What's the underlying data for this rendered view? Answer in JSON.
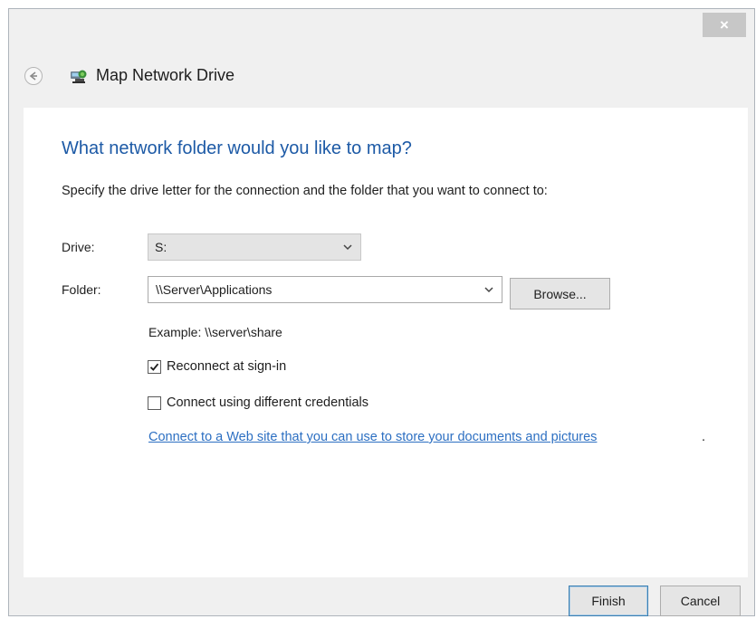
{
  "window": {
    "title": "Map Network Drive",
    "close_label": "×"
  },
  "main": {
    "heading": "What network folder would you like to map?",
    "instructions": "Specify the drive letter for the connection and the folder that you want to connect to:",
    "drive": {
      "label": "Drive:",
      "value": "S:"
    },
    "folder": {
      "label": "Folder:",
      "value": "\\\\Server\\Applications"
    },
    "browse_label": "Browse...",
    "example": "Example: \\\\server\\share",
    "reconnect": {
      "label": "Reconnect at sign-in",
      "checked": true
    },
    "credentials": {
      "label": "Connect using different credentials",
      "checked": false
    },
    "web_link": "Connect to a Web site that you can use to store your documents and pictures",
    "web_link_suffix": "."
  },
  "footer": {
    "finish_label": "Finish",
    "cancel_label": "Cancel"
  },
  "colors": {
    "heading": "#1d5aa6",
    "link": "#2c6fc2",
    "close_button": "#c7c7c7"
  }
}
